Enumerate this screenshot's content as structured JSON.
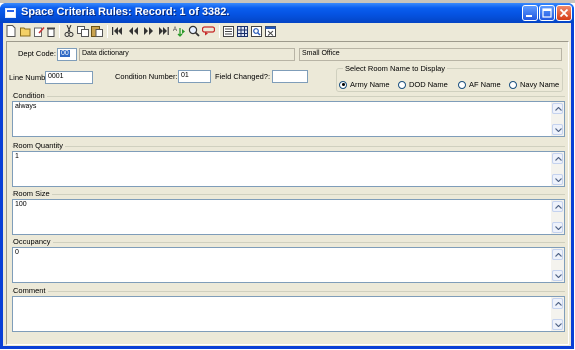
{
  "window": {
    "title": "Space Criteria Rules: Record: 1 of 3382."
  },
  "toolbar": {
    "icons": [
      "new-icon",
      "open-icon",
      "edit-icon",
      "delete-icon",
      "cut-icon",
      "copy-icon",
      "paste-icon",
      "first-record-icon",
      "previous-record-icon",
      "next-record-icon",
      "last-record-icon",
      "sort-icon",
      "find-icon",
      "undo-icon",
      "form-view-icon",
      "datasheet-view-icon",
      "print-preview-icon",
      "close-form-icon"
    ]
  },
  "form": {
    "dept_code_label": "Dept Code:",
    "dept_code": "00",
    "dept_name": "Data dictionary",
    "office": "Small Office",
    "line_number_label": "Line Number:",
    "line_number": "0001",
    "condition_number_label": "Condition Number:",
    "condition_number": "01",
    "field_changed_label": "Field Changed?:",
    "field_changed": "",
    "room_name_group": {
      "title": "Select Room Name to Display",
      "options": [
        "Army Name",
        "DOD Name",
        "AF Name",
        "Navy Name"
      ],
      "selected": "Army Name"
    },
    "sections": [
      {
        "label": "Condition",
        "value": "always"
      },
      {
        "label": "Room Quantity",
        "value": "1"
      },
      {
        "label": "Room Size",
        "value": "100"
      },
      {
        "label": "Occupancy",
        "value": "0"
      },
      {
        "label": "Comment",
        "value": ""
      }
    ]
  },
  "colors": {
    "titlebar": "#0552e0",
    "face": "#ece9d8",
    "selection": "#316ac5",
    "field_border": "#7f9db9"
  }
}
